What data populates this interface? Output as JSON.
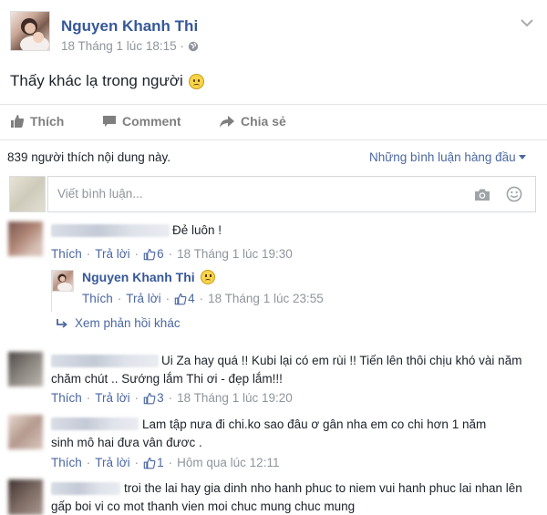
{
  "post": {
    "author": "Nguyen Khanh Thi",
    "timestamp": "18 Tháng 1 lúc 18:15 ·",
    "text": "Thấy khác lạ trong người",
    "text_emoji": "🙁"
  },
  "actions": {
    "like": "Thích",
    "comment": "Comment",
    "share": "Chia sẻ"
  },
  "likes": {
    "summary": "839 người thích nội dung này.",
    "sort_label": "Những bình luận hàng đầu"
  },
  "composer": {
    "placeholder": "Viết bình luận..."
  },
  "comments": [
    {
      "text": "Đẻ luôn !",
      "like": "Thích",
      "reply": "Trả lời",
      "sep": "·",
      "likes": "6",
      "time": "18 Tháng 1 lúc 19:30"
    },
    {
      "text": "Ui Za hay quá !! Kubi lại có em rùi !! Tiến lên thôi chịu khó vài năm chăm chút .. Sướng lắm Thi ơi - đẹp lắm!!!",
      "like": "Thích",
      "reply": "Trả lời",
      "sep": "·",
      "likes": "3",
      "time": "18 Tháng 1 lúc 19:20"
    },
    {
      "text": "Lam tập nưa đi chi.ko sao đâu ơ gân nha em co chi hơn 1 năm sinh mô hai đưa vân đươc .",
      "like": "Thích",
      "reply": "Trả lời",
      "sep": "·",
      "likes": "1",
      "time": "Hôm qua lúc 12:11"
    },
    {
      "text": "troi the lai hay gia dinh nho hanh phuc to niem vui hanh phuc lai nhan lên gấp boi vi co mot thanh vien moi chuc mung chuc mung"
    }
  ],
  "reply": {
    "author": "Nguyen Khanh Thi",
    "like": "Thích",
    "reply": "Trả lời",
    "sep": "·",
    "likes": "4",
    "time": "18 Tháng 1 lúc 23:55",
    "more_replies": "Xem phản hồi khác"
  },
  "colors": {
    "link": "#365899",
    "meta_gray": "#90949c",
    "action_gray": "#7f7f7f"
  }
}
